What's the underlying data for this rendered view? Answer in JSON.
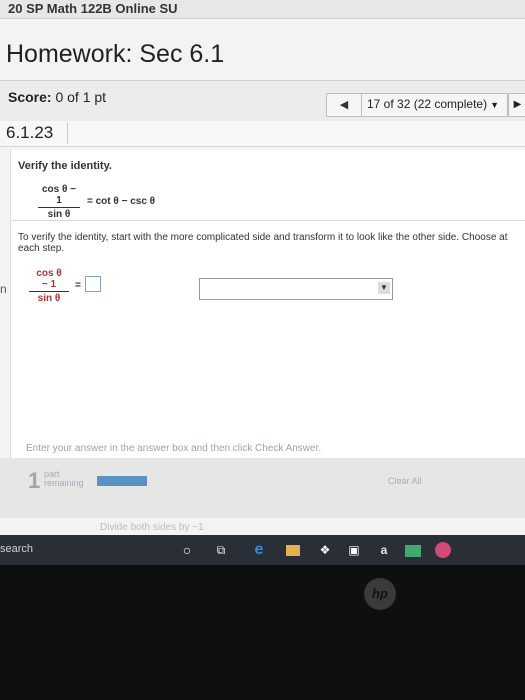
{
  "header": {
    "course": "20 SP Math 122B Online SU"
  },
  "homework": {
    "title": "Homework: Sec 6.1"
  },
  "score": {
    "label": "Score:",
    "value": "0 of 1 pt"
  },
  "pager": {
    "prev": "◀",
    "label": "17 of 32 (22 complete)",
    "caret": "▼",
    "next": "▶"
  },
  "question": {
    "number": "6.1.23",
    "verify": "Verify the identity.",
    "identity": {
      "num": "cos θ − 1",
      "den": "sin θ",
      "rhs": "= cot θ − csc θ"
    },
    "instructions": "To verify the identity, start with the more complicated side and transform it to look like the other side. Choose at each step.",
    "step": {
      "num": "cos θ − 1",
      "den": "sin θ",
      "eq": "="
    }
  },
  "footer": {
    "enter_text": "Enter your answer in the answer box and then click Check Answer.",
    "parts_count": "1",
    "parts_label_1": "part",
    "parts_label_2": "remaining",
    "clear_all": "Clear All",
    "bottom_hint": "Divide both sides by −1"
  },
  "taskbar": {
    "search": "search",
    "icons": [
      "cortana-icon",
      "task-view-icon",
      "edge-icon",
      "file-explorer-icon",
      "dropbox-icon",
      "store-icon",
      "amazon-icon",
      "mail-icon",
      "app-icon"
    ]
  },
  "bezel": {
    "brand": "hp"
  },
  "colors": {
    "progress": "#5a92c6",
    "taskbar": "#2a2f37"
  }
}
